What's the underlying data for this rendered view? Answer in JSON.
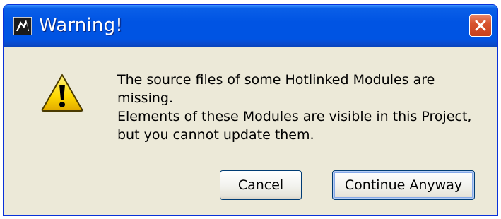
{
  "window": {
    "title": "Warning!",
    "icons": {
      "app": "app-logo-icon",
      "close": "close-icon",
      "warning": "warning-triangle-icon"
    }
  },
  "message": {
    "line1": "The source files of some Hotlinked Modules are missing.",
    "line2": "Elements of these Modules are visible in this Project, but you cannot update them."
  },
  "buttons": {
    "cancel": "Cancel",
    "continue": "Continue Anyway"
  },
  "colors": {
    "titlebar": "#0054E3",
    "dialog_bg": "#ECE9D8",
    "close_button": "#D8542F",
    "warning_yellow": "#FFD800"
  }
}
